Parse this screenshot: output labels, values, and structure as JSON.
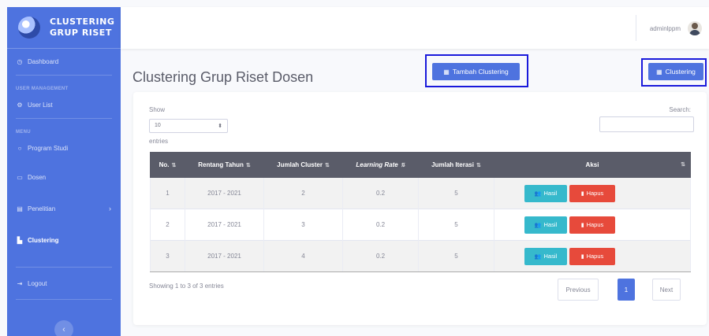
{
  "brand": {
    "line1": "CLUSTERING",
    "line2": "GRUP RISET"
  },
  "sidebar": {
    "dashboard": "Dashboard",
    "user_heading": "USER MANAGEMENT",
    "user_list": "User List",
    "menu_heading": "MENU",
    "program_studi": "Program Studi",
    "dosen": "Dosen",
    "penelitian": "Penelitian",
    "clustering": "Clustering",
    "logout": "Logout"
  },
  "topbar": {
    "username": "adminlppm"
  },
  "page": {
    "title": "Clustering Grup Riset Dosen",
    "add_button": "Tambah Clustering",
    "cluster_button": "Clustering"
  },
  "table_controls": {
    "show": "Show",
    "length": "10",
    "entries": "entries",
    "search": "Search:"
  },
  "table": {
    "headers": [
      "No.",
      "Rentang Tahun",
      "Jumlah Cluster",
      "Learning Rate",
      "Jumlah Iterasi",
      "Aksi"
    ],
    "rows": [
      {
        "no": "1",
        "rentang": "2017 - 2021",
        "cluster": "2",
        "rate": "0.2",
        "iterasi": "5"
      },
      {
        "no": "2",
        "rentang": "2017 - 2021",
        "cluster": "3",
        "rate": "0.2",
        "iterasi": "5"
      },
      {
        "no": "3",
        "rentang": "2017 - 2021",
        "cluster": "4",
        "rate": "0.2",
        "iterasi": "5"
      }
    ],
    "hasil_label": "Hasil",
    "hapus_label": "Hapus"
  },
  "footer": {
    "info": "Showing 1 to 3 of 3 entries",
    "prev": "Previous",
    "page": "1",
    "next": "Next"
  },
  "colors": {
    "primary": "#4e73df",
    "info": "#36b9cc",
    "danger": "#e74a3b",
    "header": "#5a5c69",
    "highlight": "#1a1adb"
  },
  "icons": [
    "dashboard-icon",
    "users-icon",
    "folder-icon",
    "user-icon",
    "file-icon",
    "chart-icon",
    "logout-icon",
    "chevron-right-icon",
    "chevron-left-icon",
    "table-icon",
    "users-group-icon",
    "trash-icon"
  ]
}
